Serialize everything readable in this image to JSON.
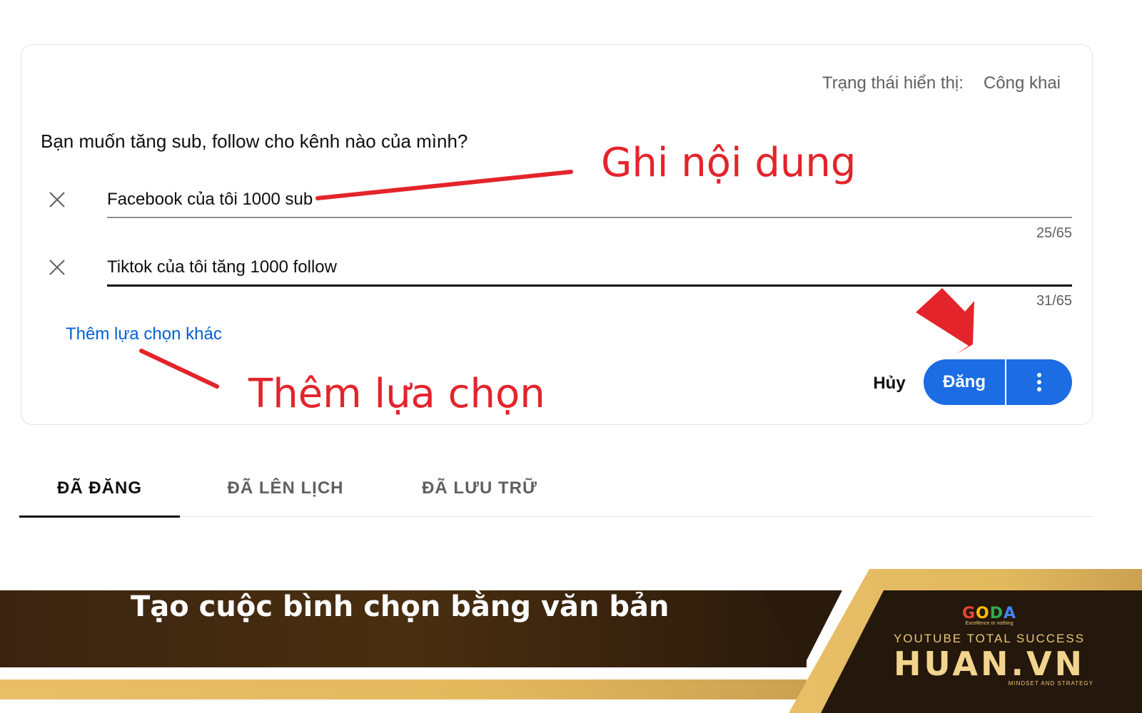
{
  "visibility": {
    "label": "Trạng thái hiển thị:",
    "value": "Công khai"
  },
  "poll": {
    "question": "Bạn muốn tăng sub, follow cho kênh nào của mình?",
    "options": [
      {
        "text": "Facebook của tôi 1000 sub",
        "count": "25/65"
      },
      {
        "text": "Tiktok của tôi tăng 1000 follow",
        "count": "31/65"
      }
    ],
    "add_choice_label": "Thêm lựa chọn khác"
  },
  "actions": {
    "cancel_label": "Hủy",
    "post_label": "Đăng",
    "more_icon": "vertical-dots-icon"
  },
  "annotations": {
    "content": "Ghi nội dung",
    "add_choice": "Thêm lựa chọn",
    "color": "#e3242b"
  },
  "tabs": [
    {
      "label": "ĐÃ ĐĂNG",
      "active": true
    },
    {
      "label": "ĐÃ LÊN LỊCH",
      "active": false
    },
    {
      "label": "ĐÃ LƯU TRỮ",
      "active": false
    }
  ],
  "banner": {
    "title": "Tạo cuộc bình chọn bằng văn bản",
    "brand_logo": "GODA",
    "brand_tagline": "Excellence or nothing",
    "brand_sub": "YOUTUBE TOTAL SUCCESS",
    "brand_main": "HUAN.VN",
    "brand_foot": "MINDSET AND STRATEGY"
  },
  "colors": {
    "accent_blue": "#1c6ce3",
    "link_blue": "#065fd4",
    "banner_brown": "#3b2410",
    "gold": "#e3b95e"
  }
}
